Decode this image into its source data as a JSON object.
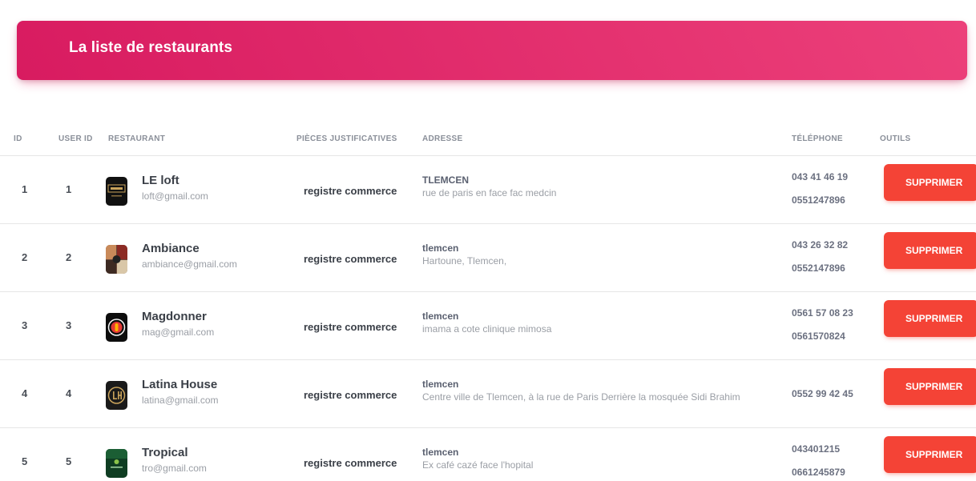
{
  "header": {
    "title": "La liste de restaurants"
  },
  "table": {
    "columns": {
      "id": "ID",
      "user_id": "USER ID",
      "restaurant": "RESTAURANT",
      "pieces": "PIÈCES JUSTIFICATIVES",
      "adresse": "ADRESSE",
      "telephone": "TÉLÉPHONE",
      "outils": "OUTILS"
    },
    "delete_label": "SUPPRIMER",
    "rows": [
      {
        "id": "1",
        "user_id": "1",
        "logo_icon": "le-loft-logo-icon",
        "name": "LE loft",
        "email": "loft@gmail.com",
        "pieces": "registre commerce",
        "city": "TLEMCEN",
        "street": "rue de paris en face fac medcin",
        "phones": [
          "043 41 46 19",
          "0551247896"
        ]
      },
      {
        "id": "2",
        "user_id": "2",
        "logo_icon": "ambiance-logo-icon",
        "name": "Ambiance",
        "email": "ambiance@gmail.com",
        "pieces": "registre commerce",
        "city": "tlemcen",
        "street": "Hartoune, Tlemcen,",
        "phones": [
          "043 26 32 82",
          "0552147896"
        ]
      },
      {
        "id": "3",
        "user_id": "3",
        "logo_icon": "magdonner-logo-icon",
        "name": "Magdonner",
        "email": "mag@gmail.com",
        "pieces": "registre commerce",
        "city": "tlemcen",
        "street": "imama a cote clinique mimosa",
        "phones": [
          "0561 57 08 23",
          "0561570824"
        ]
      },
      {
        "id": "4",
        "user_id": "4",
        "logo_icon": "latina-house-logo-icon",
        "name": "Latina House",
        "email": "latina@gmail.com",
        "pieces": "registre commerce",
        "city": "tlemcen",
        "street": "Centre ville de Tlemcen, à la rue de Paris Derrière la mosquée Sidi Brahim",
        "phones": [
          "0552 99 42 45"
        ]
      },
      {
        "id": "5",
        "user_id": "5",
        "logo_icon": "tropical-logo-icon",
        "name": "Tropical",
        "email": "tro@gmail.com",
        "pieces": "registre commerce",
        "city": "tlemcen",
        "street": "Ex café cazé face l'hopital",
        "phones": [
          "043401215",
          "0661245879"
        ]
      }
    ]
  },
  "colors": {
    "header": "#e91e63",
    "danger": "#f44336"
  }
}
